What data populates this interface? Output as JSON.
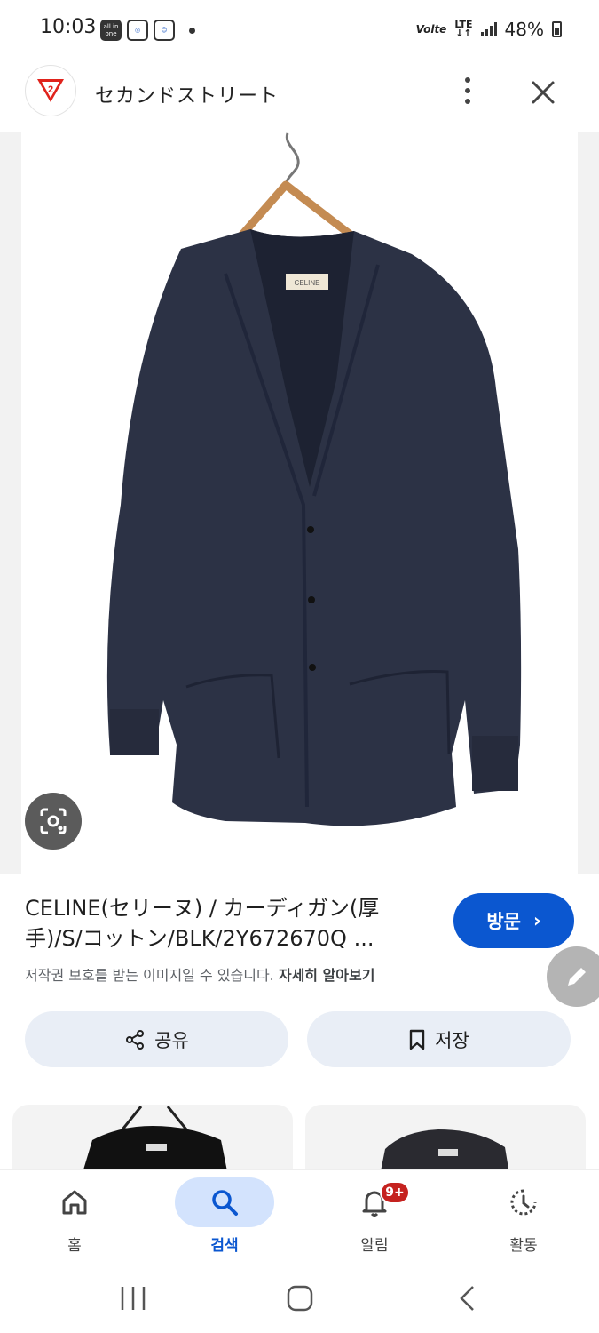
{
  "status_bar": {
    "time": "10:03",
    "notif_icons": [
      {
        "icon": "all-in-one-app-icon",
        "text": "all in one"
      },
      {
        "icon": "app-badge-icon",
        "text": ""
      },
      {
        "icon": "mascot-app-icon",
        "text": ""
      }
    ],
    "volte": "Volte",
    "network": "LTE",
    "battery": "48%"
  },
  "header": {
    "site_name": "セカンドストリート",
    "logo_text": "2"
  },
  "result": {
    "title": "CELINE(セリーヌ) / カーディガン(厚手)/S/コットン/BLK/2Y672670Q ...",
    "visit_label": "방문",
    "copyright_text": "저작권 보호를 받는 이미지일 수 있습니다.",
    "copyright_link": "자세히 알아보기",
    "share_label": "공유",
    "save_label": "저장"
  },
  "bottom_nav": {
    "items": [
      {
        "label": "홈",
        "icon": "home-icon"
      },
      {
        "label": "검색",
        "icon": "search-icon",
        "active": true
      },
      {
        "label": "알림",
        "icon": "bell-icon",
        "badge": "9+"
      },
      {
        "label": "활동",
        "icon": "activity-history-icon"
      }
    ]
  },
  "colors": {
    "accent": "#0b57d0",
    "chip_bg": "#e9eef6",
    "active_nav_bg": "#d3e3fd",
    "badge": "#c5221f"
  }
}
